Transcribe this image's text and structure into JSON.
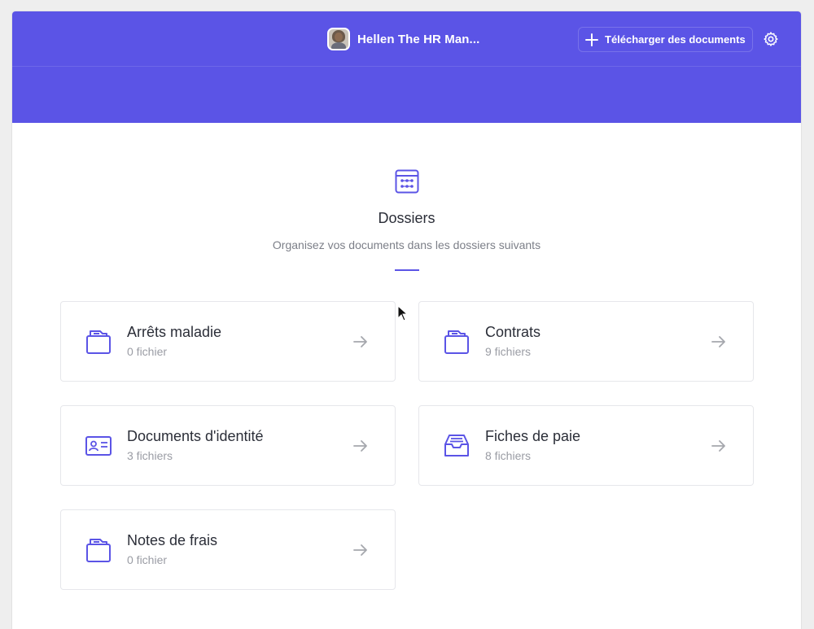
{
  "header": {
    "user_name": "Hellen The HR Man...",
    "upload_label": "Télécharger des documents",
    "background": "#5b54e6"
  },
  "section": {
    "title": "Dossiers",
    "subtitle": "Organisez vos documents dans les dossiers suivants",
    "accent": "#5b54e6"
  },
  "folders": [
    {
      "title": "Arrêts maladie",
      "count": "0 fichier",
      "icon": "folder-icon"
    },
    {
      "title": "Contrats",
      "count": "9 fichiers",
      "icon": "folder-icon"
    },
    {
      "title": "Documents d'identité",
      "count": "3 fichiers",
      "icon": "id-card-icon"
    },
    {
      "title": "Fiches de paie",
      "count": "8 fichiers",
      "icon": "inbox-tray-icon"
    },
    {
      "title": "Notes de frais",
      "count": "0 fichier",
      "icon": "folder-icon"
    }
  ]
}
